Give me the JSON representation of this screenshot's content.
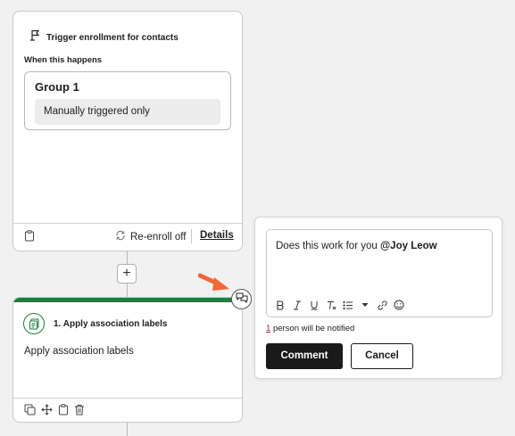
{
  "trigger_card": {
    "title": "Trigger enrollment for contacts",
    "section_label": "When this happens",
    "group_title": "Group 1",
    "group_condition": "Manually triggered only",
    "reenroll_label": "Re-enroll off",
    "details_link": "Details"
  },
  "add_step": {
    "symbol": "+"
  },
  "action_card": {
    "title": "1. Apply association labels",
    "description": "Apply association labels",
    "accent_color": "#1e7d3f"
  },
  "comment_popup": {
    "text_prefix": "Does this work for you",
    "mention": "@Joy Leow",
    "notify_count": "1",
    "notify_text": "person will be notified",
    "comment_button": "Comment",
    "cancel_button": "Cancel",
    "toolbar_icons": [
      "bold-icon",
      "italic-icon",
      "underline-icon",
      "clear-format-icon",
      "list-icon",
      "chevron-down-icon",
      "link-icon",
      "emoji-icon"
    ]
  },
  "colors": {
    "arrow": "#f2683a",
    "mention_count": "#a8233a"
  }
}
